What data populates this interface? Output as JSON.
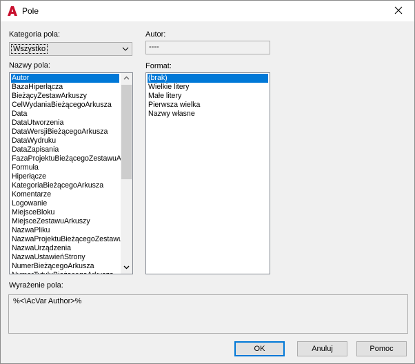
{
  "window": {
    "title": "Pole"
  },
  "category": {
    "label": "Kategoria pola:",
    "selected": "Wszystko"
  },
  "author": {
    "label": "Autor:",
    "value": "----"
  },
  "field_names": {
    "label": "Nazwy pola:",
    "items": [
      "Autor",
      "BazaHiperłącza",
      "BieżącyZestawArkuszy",
      "CelWydaniaBieżącegoArkusza",
      "Data",
      "DataUtworzenia",
      "DataWersjiBieżącegoArkusza",
      "DataWydruku",
      "DataZapisania",
      "FazaProjektuBieżącegoZestawuArk",
      "Formuła",
      "Hiperłącze",
      "KategoriaBieżącegoArkusza",
      "Komentarze",
      "Logowanie",
      "MiejsceBloku",
      "MiejsceZestawuArkuszy",
      "NazwaPliku",
      "NazwaProjektuBieżącegoZestawu",
      "NazwaUrządzenia",
      "NazwaUstawieńStrony",
      "NumerBieżącegoArkusza",
      "NumerTytułuBieżącegoArkusza"
    ],
    "selected_index": 0
  },
  "format": {
    "label": "Format:",
    "items": [
      "(brak)",
      "Wielkie litery",
      "Małe litery",
      "Pierwsza wielka",
      "Nazwy własne"
    ],
    "selected_index": 0
  },
  "expression": {
    "label": "Wyrażenie pola:",
    "value": "%<\\AcVar Author>%"
  },
  "buttons": {
    "ok": "OK",
    "cancel": "Anuluj",
    "help": "Pomoc"
  }
}
